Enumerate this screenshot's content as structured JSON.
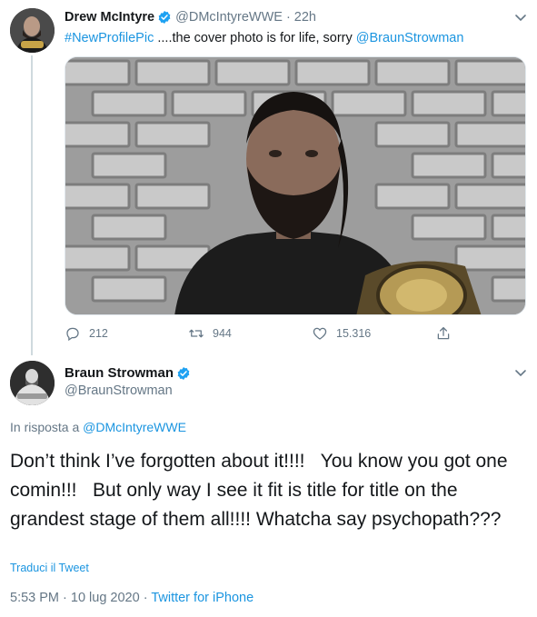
{
  "tweet1": {
    "name": "Drew McIntyre",
    "handle": "@DMcIntyreWWE",
    "separator": "·",
    "time": "22h",
    "text": {
      "hashtag": "#NewProfilePic",
      "middle": " ....the cover photo is for life, sorry ",
      "mention": "@BraunStrowman"
    },
    "actions": {
      "replies": "212",
      "retweets": "944",
      "likes": "15.316"
    }
  },
  "tweet2": {
    "name": "Braun Strowman",
    "handle": "@BraunStrowman",
    "reply_prefix": "In risposta a ",
    "reply_to": "@DMcIntyreWWE",
    "text": "Don’t think I’ve forgotten about it!!!!   You know you got one comin!!!   But only way I see it fit is title for title on the grandest stage of them all!!!! Whatcha say psychopath???",
    "translate": "Traduci il Tweet",
    "timestamp": "5:53 PM · 10 lug 2020",
    "meta_sep": " · ",
    "source": "Twitter for iPhone"
  },
  "colors": {
    "link": "#1b95e0",
    "muted": "#657786",
    "verified": "#1da1f2"
  }
}
